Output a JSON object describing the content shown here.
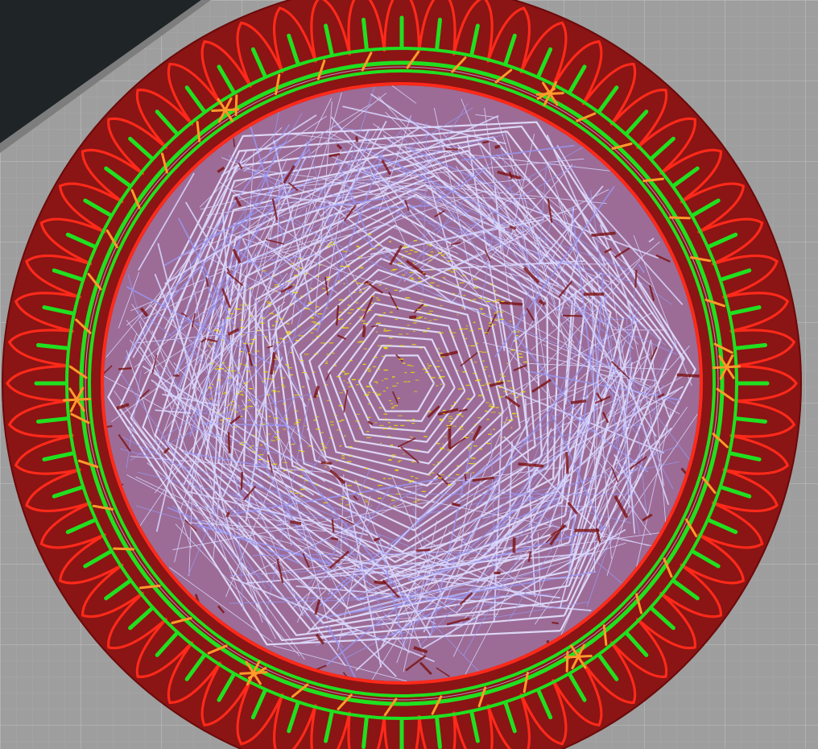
{
  "viewer": {
    "background_color": "#9e9e9e",
    "bed_grid_minor_color": "#a9a9a9",
    "bed_grid_major_color": "#b8b8b8",
    "off_bed_color": "#1f2427",
    "bed_edge_color": "#7d7d7d"
  },
  "toolpath": {
    "layer_view": "sliced-layer",
    "part_shape": "round-bowl-with-fluted-rim",
    "flute_count": 60,
    "seam_marker_count": 6,
    "line_types": [
      {
        "name": "outer-wall",
        "icon": "outer-wall-line",
        "color": "#ff2a1a"
      },
      {
        "name": "inner-wall",
        "icon": "inner-wall-line",
        "color": "#20e020"
      },
      {
        "name": "skin",
        "icon": "skin-fill",
        "color": "#8b1414"
      },
      {
        "name": "travel",
        "icon": "travel-move-line",
        "color": "#b5b3ff"
      },
      {
        "name": "infill",
        "icon": "infill-dot",
        "color": "#f0e000"
      },
      {
        "name": "seam",
        "icon": "seam-marker",
        "color": "#ff9b2a"
      }
    ]
  }
}
